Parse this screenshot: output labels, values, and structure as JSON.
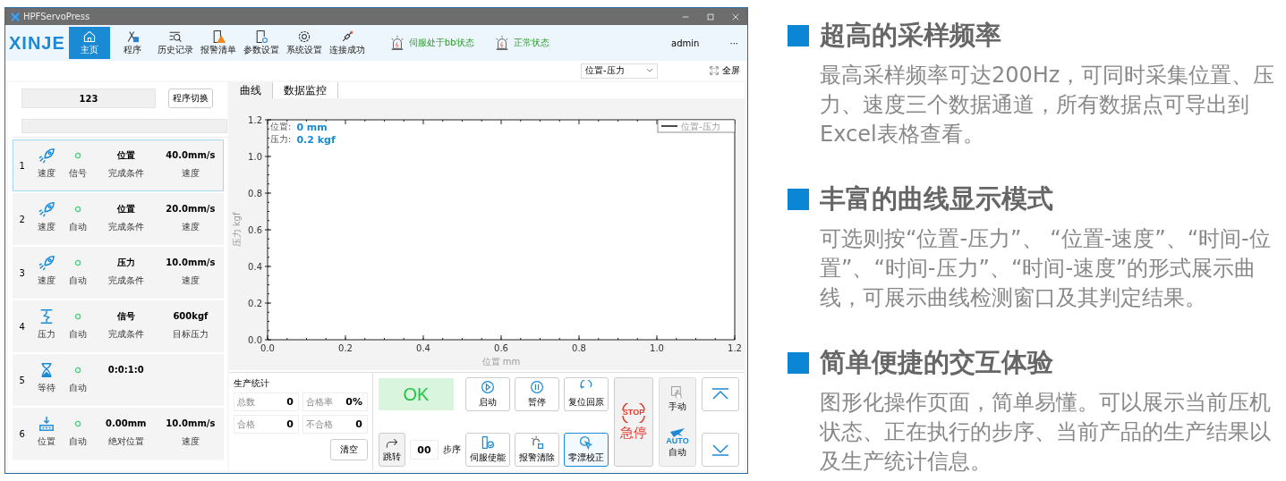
{
  "window": {
    "title": "HPFServoPress"
  },
  "toolbar": {
    "logo": "XINJE",
    "items": [
      {
        "label": "主页",
        "kind": "home",
        "selected": true
      },
      {
        "label": "程序",
        "kind": "program",
        "selected": false
      },
      {
        "label": "历史记录",
        "kind": "history",
        "selected": false
      },
      {
        "label": "报警清单",
        "kind": "alarm",
        "selected": false
      },
      {
        "label": "参数设置",
        "kind": "params",
        "selected": false
      },
      {
        "label": "系统设置",
        "kind": "settings",
        "selected": false
      },
      {
        "label": "连接成功",
        "kind": "link",
        "selected": false
      }
    ],
    "statuses": [
      "伺服处于bb状态",
      "正常状态"
    ],
    "user": "admin",
    "more": "···"
  },
  "view_bar": {
    "mode_select": "位置-压力",
    "fullscreen": "全屏"
  },
  "program": {
    "name": "123",
    "switch_button": "程序切换",
    "progress": {
      "level": 0
    }
  },
  "steps": [
    {
      "number": "1",
      "kind": "speed",
      "type": "速度",
      "mode": "信号",
      "value": "位置",
      "value_label": "完成条件",
      "param": "40.0mm/s",
      "param_label": "速度",
      "selected": true
    },
    {
      "number": "2",
      "kind": "speed",
      "type": "速度",
      "mode": "自动",
      "value": "位置",
      "value_label": "完成条件",
      "param": "20.0mm/s",
      "param_label": "速度",
      "selected": false
    },
    {
      "number": "3",
      "kind": "speed",
      "type": "速度",
      "mode": "自动",
      "value": "压力",
      "value_label": "完成条件",
      "param": "10.0mm/s",
      "param_label": "速度",
      "selected": false
    },
    {
      "number": "4",
      "kind": "press",
      "type": "压力",
      "mode": "自动",
      "value": "信号",
      "value_label": "完成条件",
      "param": "600kgf",
      "param_label": "目标压力",
      "selected": false
    },
    {
      "number": "5",
      "kind": "wait",
      "type": "等待",
      "mode": "自动",
      "value": "0:0:1:0",
      "selected": false
    },
    {
      "number": "6",
      "kind": "position",
      "type": "位置",
      "mode": "自动",
      "value": "0.00mm",
      "value_label": "绝对位置",
      "param": "10.0mm/s",
      "param_label": "速度",
      "selected": false
    }
  ],
  "tabs": [
    {
      "label": "曲线",
      "selected": true
    },
    {
      "label": "数据监控",
      "selected": false
    }
  ],
  "readouts": [
    {
      "label": "位置:",
      "value": "0 mm"
    },
    {
      "label": "压力:",
      "value": "0.2 kgf"
    }
  ],
  "chart_data": {
    "type": "line",
    "xlabel": "位置 mm",
    "ylabel": "压力 kgf",
    "categories": [
      "0.0",
      "0.2",
      "0.4",
      "0.6",
      "0.8",
      "1.0",
      "1.2"
    ],
    "ylim": [
      0,
      1.2
    ],
    "yticks": [
      {
        "value": 0,
        "label": "0.0"
      },
      {
        "value": 0.2,
        "label": "0.2"
      },
      {
        "value": 0.4,
        "label": "0.4"
      },
      {
        "value": 0.6,
        "label": "0.6"
      },
      {
        "value": 0.8,
        "label": "0.8"
      },
      {
        "value": 1,
        "label": "1.0"
      },
      {
        "value": 1.2,
        "label": "1.2"
      }
    ],
    "series": [
      {
        "name": "位置-压力",
        "color": "#111111",
        "values": [
          null,
          null,
          null,
          null,
          null,
          null,
          null
        ]
      }
    ]
  },
  "stats": {
    "title": "生产统计",
    "cells": [
      {
        "label": "总数",
        "value": "0"
      },
      {
        "label": "合格率",
        "value": "0%"
      },
      {
        "label": "合格",
        "value": "0"
      },
      {
        "label": "不合格",
        "value": "0"
      }
    ],
    "clear_button": "清空"
  },
  "controls": {
    "result": "OK",
    "top_buttons": [
      {
        "label": "启动",
        "kind": "play",
        "selected": false
      },
      {
        "label": "暂停",
        "kind": "pause",
        "selected": false
      },
      {
        "label": "复位回原",
        "kind": "reset",
        "selected": false
      }
    ],
    "jump_button": "跳转",
    "step_value": "00",
    "step_label": "步序",
    "bottom_buttons": [
      {
        "label": "伺服使能",
        "kind": "servo",
        "selected": false
      },
      {
        "label": "报警清除",
        "kind": "clear",
        "selected": false
      },
      {
        "label": "零漂校正",
        "kind": "zero",
        "selected": true
      }
    ],
    "stop_icon_text": "STOP",
    "stop_button": "急停",
    "manual_button": "手动",
    "auto_icon_text": "AUTO",
    "auto_button": "自动"
  },
  "features": [
    {
      "title": "超高的采样频率",
      "text": "最高采样频率可达200Hz，可同时采集位置、压力、速度三个数据通道，所有数据点可导出到Excel表格查看。"
    },
    {
      "title": "丰富的曲线显示模式",
      "text": "可选则按“位置-压力”、 “位置-速度”、“时间-位置”、“时间-压力”、“时间-速度”的形式展示曲线，可展示曲线检测窗口及其判定结果。"
    },
    {
      "title": "简单便捷的交互体验",
      "text": "图形化操作页面，简单易懂。可以展示当前压机状态、正在执行的步序、当前产品的生产结果以及生产统计信息。"
    }
  ]
}
